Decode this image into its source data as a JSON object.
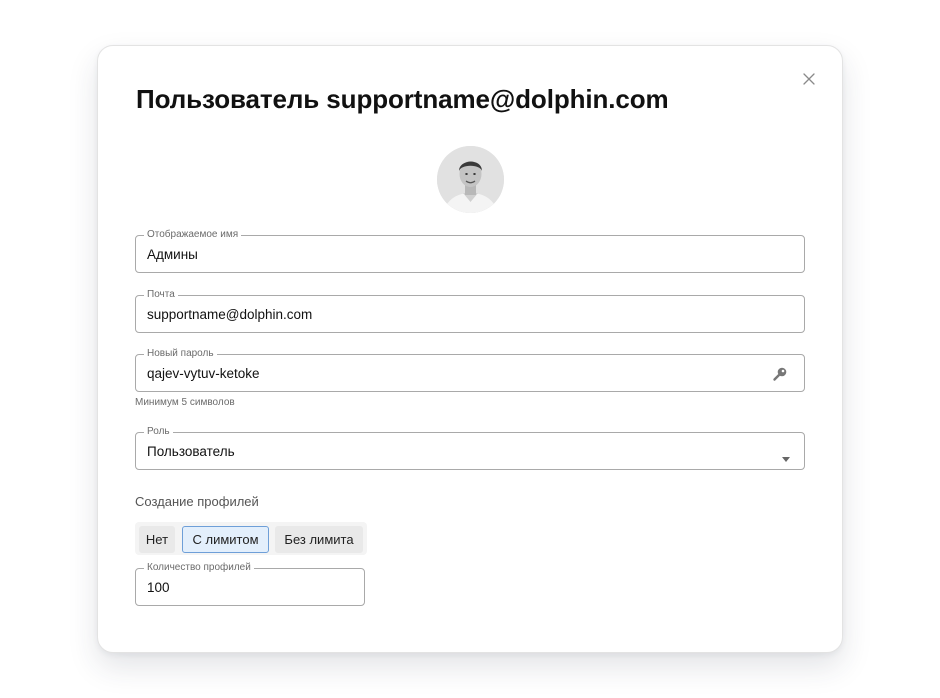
{
  "modal": {
    "title": "Пользователь supportname@dolphin.com",
    "close_icon": "close-icon",
    "avatar_icon": "user-avatar"
  },
  "fields": {
    "display_name": {
      "label": "Отображаемое имя",
      "value": "Админы"
    },
    "email": {
      "label": "Почта",
      "value": "supportname@dolphin.com"
    },
    "password": {
      "label": "Новый пароль",
      "value": "qajev-vytuv-ketoke",
      "helper": "Минимум 5 символов",
      "icon": "key-icon"
    },
    "role": {
      "label": "Роль",
      "value": "Пользователь",
      "icon": "chevron-down-icon"
    }
  },
  "profile_creation": {
    "label": "Создание профилей",
    "options": [
      "Нет",
      "С лимитом",
      "Без лимита"
    ],
    "selected": "С лимитом",
    "count": {
      "label": "Количество профилей",
      "value": "100"
    }
  },
  "colors": {
    "accent_border": "#6e9fd8",
    "accent_bg": "#e3effc"
  }
}
